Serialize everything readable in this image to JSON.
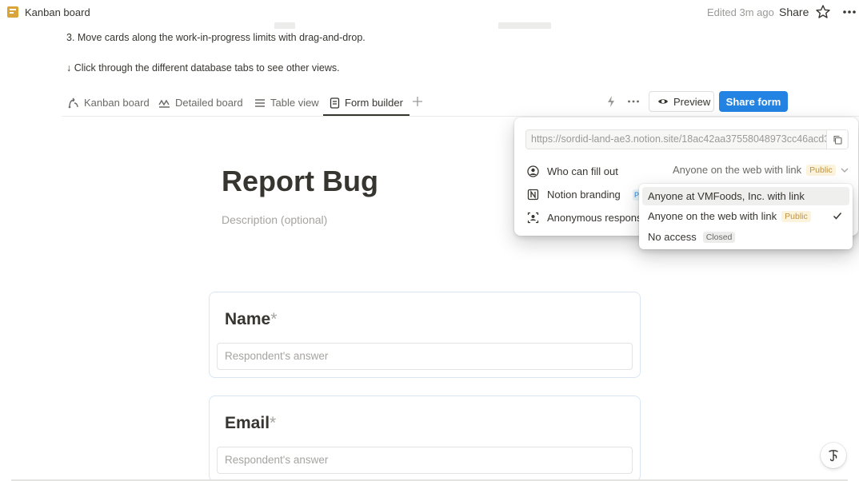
{
  "topbar": {
    "page_title": "Kanban board",
    "edited": "Edited 3m ago",
    "share": "Share"
  },
  "content": {
    "step3": "3. Move cards along the work-in-progress limits with drag-and-drop.",
    "hint": "↓ Click through the different database tabs to see other views."
  },
  "tabs": [
    {
      "label": "Kanban board",
      "icon": "kanban-icon"
    },
    {
      "label": "Detailed board",
      "icon": "board-icon"
    },
    {
      "label": "Table view",
      "icon": "table-icon"
    },
    {
      "label": "Form builder",
      "icon": "form-icon",
      "active": true
    }
  ],
  "toolbar": {
    "preview": "Preview",
    "share_form": "Share form"
  },
  "form": {
    "title": "Report Bug",
    "description_placeholder": "Description (optional)",
    "questions": [
      {
        "title": "Name",
        "required_mark": "*",
        "answer_placeholder": "Respondent's answer"
      },
      {
        "title": "Email",
        "required_mark": "*",
        "answer_placeholder": "Respondent's answer"
      }
    ]
  },
  "share_panel": {
    "url": "https://sordid-land-ae3.notion.site/18ac42aa37558048973cc46acd3",
    "who_label": "Who can fill out",
    "who_value": "Anyone on the web with link",
    "who_badge": "Public",
    "branding_label": "Notion branding",
    "branding_badge": "P",
    "anonymous_label": "Anonymous respons"
  },
  "access_menu": {
    "items": [
      {
        "label": "Anyone at VMFoods, Inc. with link",
        "badge": "",
        "selected": false
      },
      {
        "label": "Anyone on the web with link",
        "badge": "Public",
        "selected": true
      },
      {
        "label": "No access",
        "badge": "Closed",
        "selected": false
      }
    ]
  },
  "colors": {
    "accent": "#2383e2",
    "text": "#37352f",
    "muted": "#9b9a97",
    "page_icon": "#d9a53b"
  }
}
